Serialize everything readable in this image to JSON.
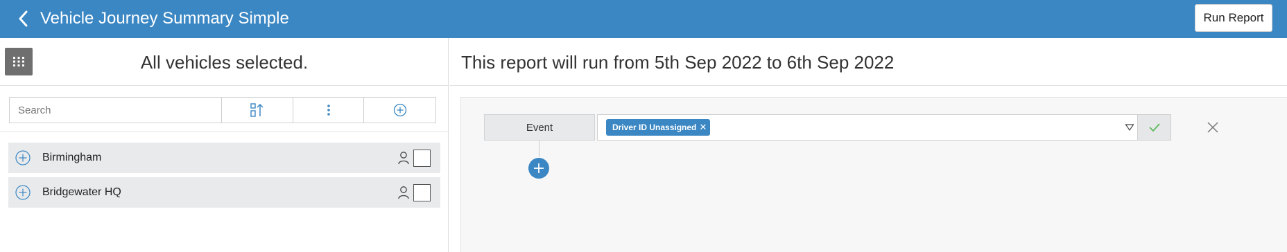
{
  "header": {
    "title": "Vehicle Journey Summary Simple",
    "run_button": "Run Report",
    "background": "#3b87c4"
  },
  "left_panel": {
    "selection_text": "All vehicles selected.",
    "search_placeholder": "Search",
    "toolbar_icons": [
      "sort-icon",
      "more-vertical-icon",
      "add-circle-icon"
    ],
    "groups": [
      {
        "name": "Birmingham",
        "checked": false
      },
      {
        "name": "Bridgewater HQ",
        "checked": false
      }
    ]
  },
  "right_panel": {
    "range_text": "This report will run from 5th Sep 2022 to 6th Sep 2022",
    "event_label": "Event",
    "filter_tag": "Driver ID Unassigned",
    "accent": "#3b87c4",
    "confirm_color": "#5cb85c"
  }
}
